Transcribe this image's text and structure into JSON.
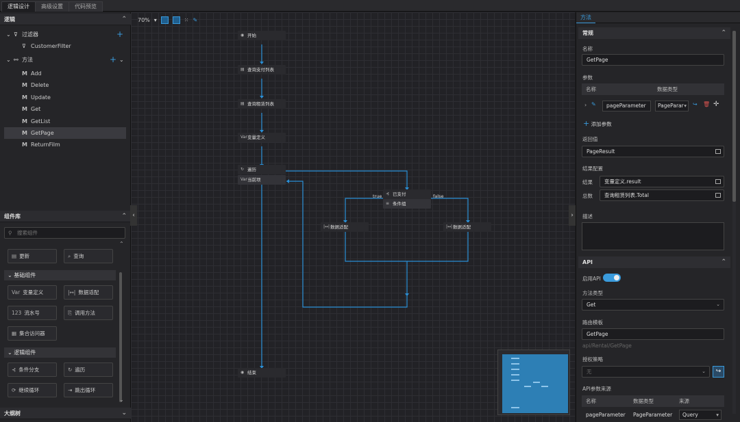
{
  "tabs": [
    "逻辑设计",
    "高级设置",
    "代码预览"
  ],
  "left": {
    "logic_title": "逻辑",
    "filter_label": "过滤器",
    "filter_children": [
      "CustomerFilter"
    ],
    "method_label": "方法",
    "methods": [
      "Add",
      "Delete",
      "Update",
      "Get",
      "GetList",
      "GetPage",
      "ReturnFilm"
    ],
    "method_icon": "M",
    "selected_method": "GetPage",
    "components_title": "组件库",
    "search_placeholder": "搜索组件",
    "top_components": [
      "更新",
      "查询"
    ],
    "basic_group": "基础组件",
    "basic_components": [
      "变量定义",
      "数据适配",
      "流水号",
      "调用方法",
      "集合访问器"
    ],
    "logic_group": "逻辑组件",
    "logic_components": [
      "条件分支",
      "遍历",
      "继续循环",
      "跳出循环"
    ],
    "outline_title": "大纲树"
  },
  "canvas": {
    "zoom": "70%",
    "nodes": [
      "开始",
      "查询支付列表",
      "查询租赁列表",
      "变量定义",
      "遍历",
      "当前项",
      "已支付",
      "条件组",
      "数据适配",
      "数据适配",
      "结束"
    ],
    "edge_true": "true",
    "edge_false": "false"
  },
  "right": {
    "tab": "方法",
    "general_title": "常规",
    "name_label": "名称",
    "name_value": "GetPage",
    "params_label": "参数",
    "params_headers": [
      "名称",
      "数据类型"
    ],
    "param_name": "pageParameter",
    "param_type": "PageParar",
    "add_param": "添加参数",
    "return_label": "返回值",
    "return_value": "PageResult",
    "result_config_label": "结果配置",
    "result_label": "结果",
    "result_value": "变量定义.result",
    "total_label": "总数",
    "total_value": "查询租赁列表.Total",
    "desc_label": "描述",
    "api_title": "API",
    "enable_api_label": "启用API",
    "method_type_label": "方法类型",
    "method_type_value": "Get",
    "route_label": "路由模板",
    "route_value": "GetPage",
    "route_hint": "api/Rental/GetPage",
    "auth_label": "授权策略",
    "auth_value": "无",
    "api_source_label": "API参数来源",
    "api_headers": [
      "名称",
      "数据类型",
      "来源"
    ],
    "api_row": [
      "pageParameter",
      "PageParameter",
      "Query"
    ]
  },
  "colors": {
    "accent": "#3a9bdc",
    "bg": "#1e1e21"
  }
}
